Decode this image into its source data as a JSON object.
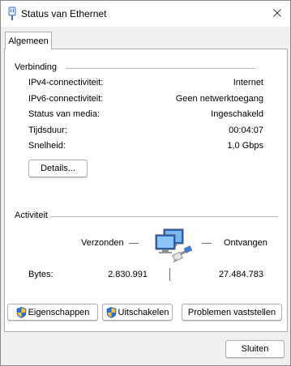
{
  "window": {
    "title": "Status van Ethernet"
  },
  "tabs": [
    {
      "label": "Algemeen"
    }
  ],
  "connection": {
    "heading": "Verbinding",
    "rows": [
      {
        "label": "IPv4-connectiviteit:",
        "value": "Internet"
      },
      {
        "label": "IPv6-connectiviteit:",
        "value": "Geen netwerktoegang"
      },
      {
        "label": "Status van media:",
        "value": "Ingeschakeld"
      },
      {
        "label": "Tijdsduur:",
        "value": "00:04:07"
      },
      {
        "label": "Snelheid:",
        "value": "1,0 Gbps"
      }
    ],
    "details_button": "Details..."
  },
  "activity": {
    "heading": "Activiteit",
    "sent_label": "Verzonden",
    "received_label": "Ontvangen",
    "bytes_label": "Bytes:",
    "bytes_sent": "2.830.991",
    "bytes_received": "27.484.783"
  },
  "buttons": {
    "properties": "Eigenschappen",
    "disable": "Uitschakelen",
    "diagnose": "Problemen vaststellen",
    "close": "Sluiten"
  },
  "icons": {
    "title": "ethernet-plug-icon",
    "close": "close-icon",
    "shield": "uac-shield-icon",
    "activity": "network-computers-icon"
  },
  "colors": {
    "window_bg": "#f0f0f0",
    "panel_bg": "#ffffff",
    "border": "#adadad",
    "shield_blue": "#2f6fd6",
    "shield_yellow": "#f2c531"
  }
}
